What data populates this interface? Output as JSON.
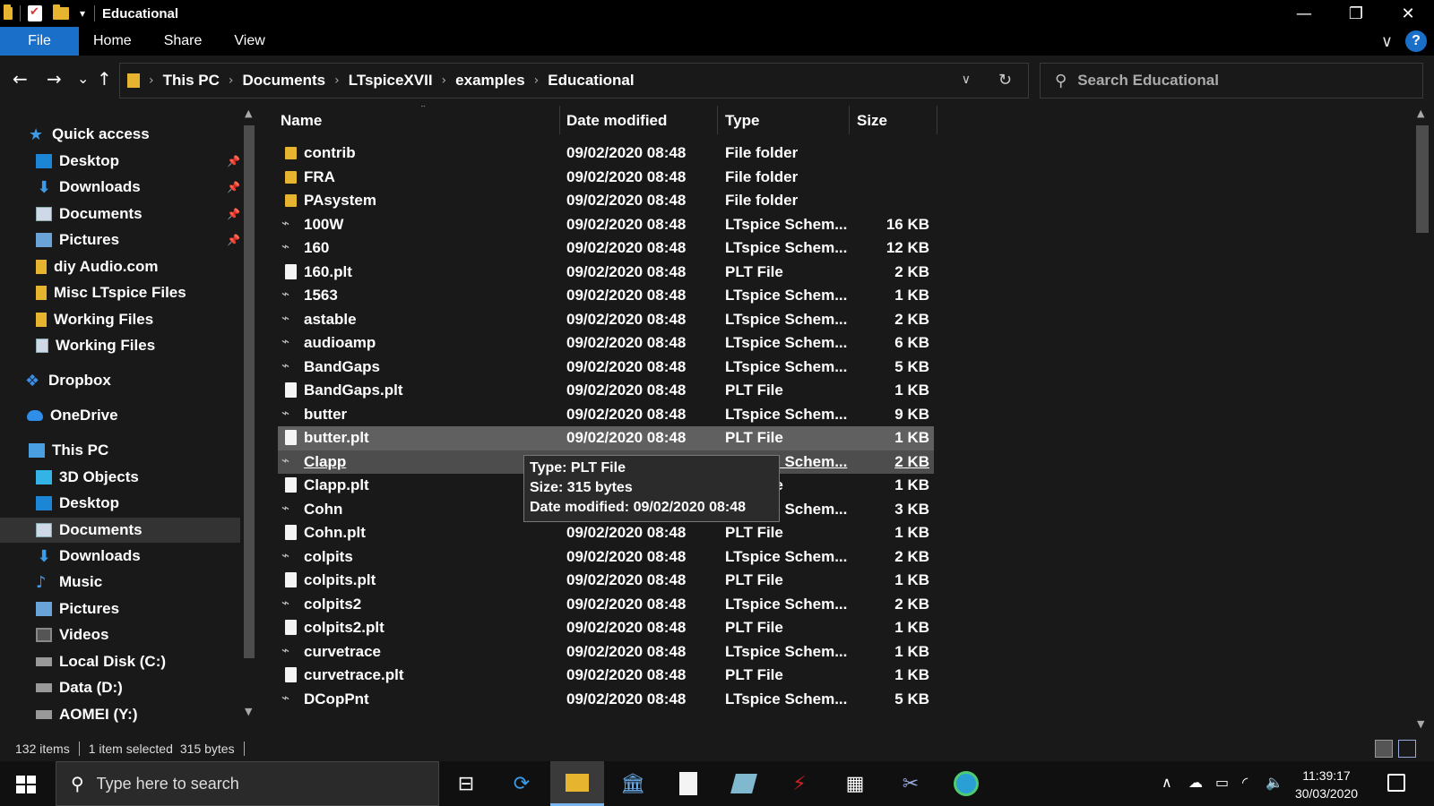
{
  "window": {
    "title": "Educational",
    "minimize": "—",
    "maximize": "❐",
    "close": "✕"
  },
  "ribbon": {
    "tabs": [
      "File",
      "Home",
      "Share",
      "View"
    ],
    "help": "?",
    "expand": "∨"
  },
  "nav": {
    "back": "←",
    "forward": "→",
    "recent": "⌄",
    "up": "↑"
  },
  "address": {
    "crumbs": [
      "This PC",
      "Documents",
      "LTspiceXVII",
      "examples",
      "Educational"
    ],
    "separator": "›",
    "dropdown": "∨",
    "refresh": "↻"
  },
  "search": {
    "placeholder": "Search Educational"
  },
  "sidebar": {
    "items": [
      {
        "label": "Quick access",
        "icon": "star-icon",
        "pinned": false
      },
      {
        "label": "Desktop",
        "icon": "desktop-icon",
        "pinned": true
      },
      {
        "label": "Downloads",
        "icon": "download-icon",
        "pinned": true
      },
      {
        "label": "Documents",
        "icon": "documents-icon",
        "pinned": true
      },
      {
        "label": "Pictures",
        "icon": "pictures-icon",
        "pinned": true
      },
      {
        "label": "diy Audio.com",
        "icon": "folder-icon",
        "pinned": false
      },
      {
        "label": "Misc LTspice Files",
        "icon": "folder-icon",
        "pinned": false
      },
      {
        "label": "Working Files",
        "icon": "folder-icon",
        "pinned": false
      },
      {
        "label": "Working Files",
        "icon": "network-folder-icon",
        "pinned": false
      },
      {
        "label": "Dropbox",
        "icon": "dropbox-icon",
        "pinned": false
      },
      {
        "label": "OneDrive",
        "icon": "onedrive-icon",
        "pinned": false
      },
      {
        "label": "This PC",
        "icon": "this-pc-icon",
        "pinned": false
      },
      {
        "label": "3D Objects",
        "icon": "3d-objects-icon",
        "pinned": false
      },
      {
        "label": "Desktop",
        "icon": "desktop-icon",
        "pinned": false
      },
      {
        "label": "Documents",
        "icon": "documents-icon",
        "pinned": false,
        "selected": true
      },
      {
        "label": "Downloads",
        "icon": "download-icon",
        "pinned": false
      },
      {
        "label": "Music",
        "icon": "music-icon",
        "pinned": false
      },
      {
        "label": "Pictures",
        "icon": "pictures-icon",
        "pinned": false
      },
      {
        "label": "Videos",
        "icon": "videos-icon",
        "pinned": false
      },
      {
        "label": "Local Disk (C:)",
        "icon": "local-disk-icon",
        "pinned": false
      },
      {
        "label": "Data (D:)",
        "icon": "drive-icon",
        "pinned": false
      },
      {
        "label": "AOMEI (Y:)",
        "icon": "drive-icon",
        "pinned": false
      }
    ]
  },
  "filelist": {
    "columns": {
      "name": "Name",
      "date": "Date modified",
      "type": "Type",
      "size": "Size"
    },
    "rows": [
      {
        "name": "contrib",
        "date": "09/02/2020 08:48",
        "type": "File folder",
        "size": "",
        "kind": "folder"
      },
      {
        "name": "FRA",
        "date": "09/02/2020 08:48",
        "type": "File folder",
        "size": "",
        "kind": "folder"
      },
      {
        "name": "PAsystem",
        "date": "09/02/2020 08:48",
        "type": "File folder",
        "size": "",
        "kind": "folder"
      },
      {
        "name": "100W",
        "date": "09/02/2020 08:48",
        "type": "LTspice Schem...",
        "size": "16 KB",
        "kind": "schem"
      },
      {
        "name": "160",
        "date": "09/02/2020 08:48",
        "type": "LTspice Schem...",
        "size": "12 KB",
        "kind": "schem"
      },
      {
        "name": "160.plt",
        "date": "09/02/2020 08:48",
        "type": "PLT File",
        "size": "2 KB",
        "kind": "file"
      },
      {
        "name": "1563",
        "date": "09/02/2020 08:48",
        "type": "LTspice Schem...",
        "size": "1 KB",
        "kind": "schem"
      },
      {
        "name": "astable",
        "date": "09/02/2020 08:48",
        "type": "LTspice Schem...",
        "size": "2 KB",
        "kind": "schem"
      },
      {
        "name": "audioamp",
        "date": "09/02/2020 08:48",
        "type": "LTspice Schem...",
        "size": "6 KB",
        "kind": "schem"
      },
      {
        "name": "BandGaps",
        "date": "09/02/2020 08:48",
        "type": "LTspice Schem...",
        "size": "5 KB",
        "kind": "schem"
      },
      {
        "name": "BandGaps.plt",
        "date": "09/02/2020 08:48",
        "type": "PLT File",
        "size": "1 KB",
        "kind": "file"
      },
      {
        "name": "butter",
        "date": "09/02/2020 08:48",
        "type": "LTspice Schem...",
        "size": "9 KB",
        "kind": "schem"
      },
      {
        "name": "butter.plt",
        "date": "09/02/2020 08:48",
        "type": "PLT File",
        "size": "1 KB",
        "kind": "file",
        "state": "hover"
      },
      {
        "name": "Clapp",
        "date": "09/02/2020 08:48",
        "type": "LTspice Schem...",
        "size": "2 KB",
        "kind": "schem",
        "state": "selected"
      },
      {
        "name": "Clapp.plt",
        "date": "09/02/2020 08:48",
        "type": "PLT File",
        "size": "1 KB",
        "kind": "file"
      },
      {
        "name": "Cohn",
        "date": "09/02/2020 08:48",
        "type": "LTspice Schem...",
        "size": "3 KB",
        "kind": "schem"
      },
      {
        "name": "Cohn.plt",
        "date": "09/02/2020 08:48",
        "type": "PLT File",
        "size": "1 KB",
        "kind": "file"
      },
      {
        "name": "colpits",
        "date": "09/02/2020 08:48",
        "type": "LTspice Schem...",
        "size": "2 KB",
        "kind": "schem"
      },
      {
        "name": "colpits.plt",
        "date": "09/02/2020 08:48",
        "type": "PLT File",
        "size": "1 KB",
        "kind": "file"
      },
      {
        "name": "colpits2",
        "date": "09/02/2020 08:48",
        "type": "LTspice Schem...",
        "size": "2 KB",
        "kind": "schem"
      },
      {
        "name": "colpits2.plt",
        "date": "09/02/2020 08:48",
        "type": "PLT File",
        "size": "1 KB",
        "kind": "file"
      },
      {
        "name": "curvetrace",
        "date": "09/02/2020 08:48",
        "type": "LTspice Schem...",
        "size": "1 KB",
        "kind": "schem"
      },
      {
        "name": "curvetrace.plt",
        "date": "09/02/2020 08:48",
        "type": "PLT File",
        "size": "1 KB",
        "kind": "file"
      },
      {
        "name": "DCopPnt",
        "date": "09/02/2020 08:48",
        "type": "LTspice Schem...",
        "size": "5 KB",
        "kind": "schem"
      }
    ]
  },
  "tooltip": {
    "type": "Type: PLT File",
    "size": "Size: 315 bytes",
    "date": "Date modified: 09/02/2020 08:48"
  },
  "status": {
    "items": "132 items",
    "selection": "1 item selected",
    "bytes": "315 bytes"
  },
  "taskbar": {
    "search_placeholder": "Type here to search",
    "time": "11:39:17",
    "date": "30/03/2020"
  },
  "colors": {
    "accent": "#1a6fc9",
    "folder": "#e7b42f",
    "background": "#191919"
  }
}
